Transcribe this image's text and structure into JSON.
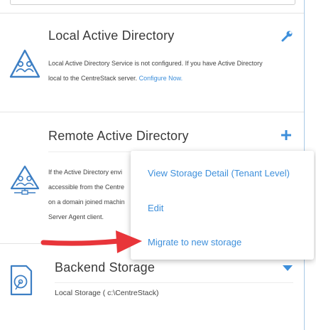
{
  "sections": {
    "local_ad": {
      "title": "Local Active Directory",
      "description_line1": "Local Active Directory Service is not configured. If you have Active Directory",
      "description_line2": "local to the CentreStack server.",
      "configure_link": "Configure Now.",
      "action_icon": "wrench-icon"
    },
    "remote_ad": {
      "title": "Remote Active Directory",
      "description_lines": [
        "If the Active Directory envi",
        "accessible from the Centre",
        "on a domain joined machin",
        "Server Agent client."
      ],
      "action_icon": "plus-icon"
    },
    "backend_storage": {
      "title": "Backend Storage",
      "detail": "Local Storage ( c:\\CentreStack)",
      "action_icon": "caret-down-icon"
    }
  },
  "dropdown_menu": {
    "items": [
      "View Storage Detail (Tenant Level)",
      "Edit",
      "Migrate to new storage"
    ]
  },
  "colors": {
    "accent": "#3d8fdb",
    "annotation_arrow": "#e8353a"
  }
}
